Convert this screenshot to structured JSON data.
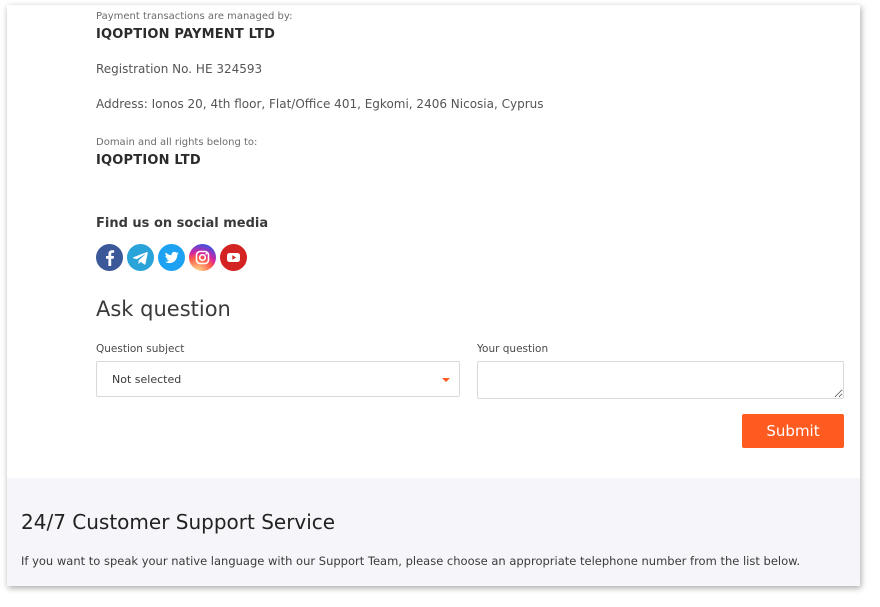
{
  "legal": {
    "payment_caption": "Payment transactions are managed by:",
    "payment_company": "IQOPTION PAYMENT LTD",
    "registration": "Registration No. HE 324593",
    "address": "Address: Ionos 20, 4th floor, Flat/Office 401, Egkomi, 2406 Nicosia, Cyprus",
    "domain_caption": "Domain and all rights belong to:",
    "domain_company": "IQOPTION LTD"
  },
  "social": {
    "title": "Find us on social media",
    "icons": [
      {
        "name": "facebook-icon",
        "color": "#3b5998"
      },
      {
        "name": "telegram-icon",
        "color": "#2aa3d9"
      },
      {
        "name": "twitter-icon",
        "color": "#1da1f2"
      },
      {
        "name": "instagram-icon",
        "color": "#c13584"
      },
      {
        "name": "youtube-icon",
        "color": "#d32323"
      }
    ]
  },
  "ask": {
    "title": "Ask question",
    "subject_label": "Question subject",
    "subject_value": "Not selected",
    "question_label": "Your question",
    "question_value": "",
    "submit_label": "Submit"
  },
  "support": {
    "title": "24/7 Customer Support Service",
    "text": "If you want to speak your native language with our Support Team, please choose an appropriate telephone number from the list below."
  },
  "colors": {
    "accent": "#ff5a1f",
    "support_bg": "#f6f6fa"
  }
}
